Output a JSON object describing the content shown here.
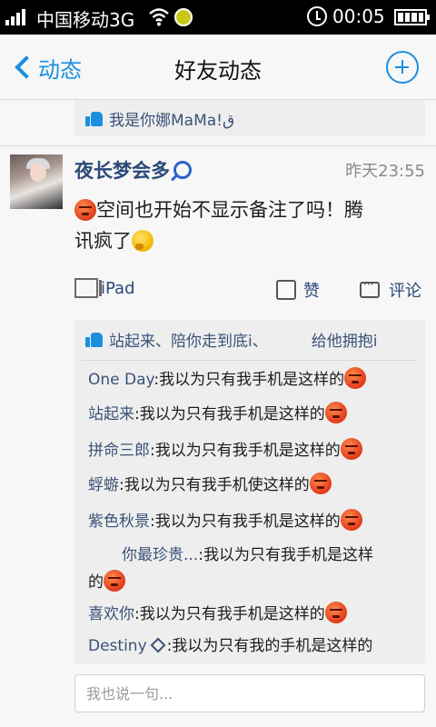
{
  "status_bar": {
    "carrier": "中国移动3G",
    "time": "00:05"
  },
  "nav": {
    "back_label": "动态",
    "title": "好友动态"
  },
  "previous_post": {
    "likes_text": "我是你娜MaMa!ق"
  },
  "post": {
    "author": "夜长梦会多",
    "timestamp": "昨天23:55",
    "content_line1": "空间也开始不显示备注了吗！腾",
    "content_line2": "讯疯了",
    "device": "iPad",
    "like_label": "赞",
    "comment_label": "评论",
    "likes_text": "站起来、陪你走到底i、",
    "likes_extra": "给他拥抱i",
    "comments": [
      {
        "name": "One Day",
        "text": ":我以为只有我手机是这样的"
      },
      {
        "name": "站起来",
        "text": ":我以为只有我手机是这样的"
      },
      {
        "name": "拼命三郎",
        "text": ":我以为只有我手机是这样的"
      },
      {
        "name": "蜉蝣",
        "text": ":我以为只有我手机使这样的"
      },
      {
        "name": "紫色秋景",
        "text": ":我以为只有我手机是这样的"
      },
      {
        "name": "你最珍贵...",
        "text": ":我以为只有我手机是这样",
        "text2": "的"
      },
      {
        "name": "喜欢你",
        "text": ":我以为只有我手机是这样的"
      },
      {
        "name": "Destiny",
        "text": ":我以为只有我的手机是这样的"
      }
    ]
  },
  "input": {
    "placeholder": "我也说一句..."
  },
  "colors": {
    "accent": "#1a8fe0",
    "name_link": "#3a5277",
    "author": "#2a4a78",
    "status_bar_bg": "#000000"
  },
  "icons": [
    "signal-icon",
    "wifi-icon",
    "coin-icon",
    "alarm-icon",
    "battery-icon",
    "chevron-left-icon",
    "plus-circle-icon",
    "thumbs-up-icon",
    "lollipop-icon",
    "angry-emoji-icon",
    "thinking-emoji-icon",
    "ipad-icon",
    "comment-icon",
    "diamond-icon"
  ]
}
